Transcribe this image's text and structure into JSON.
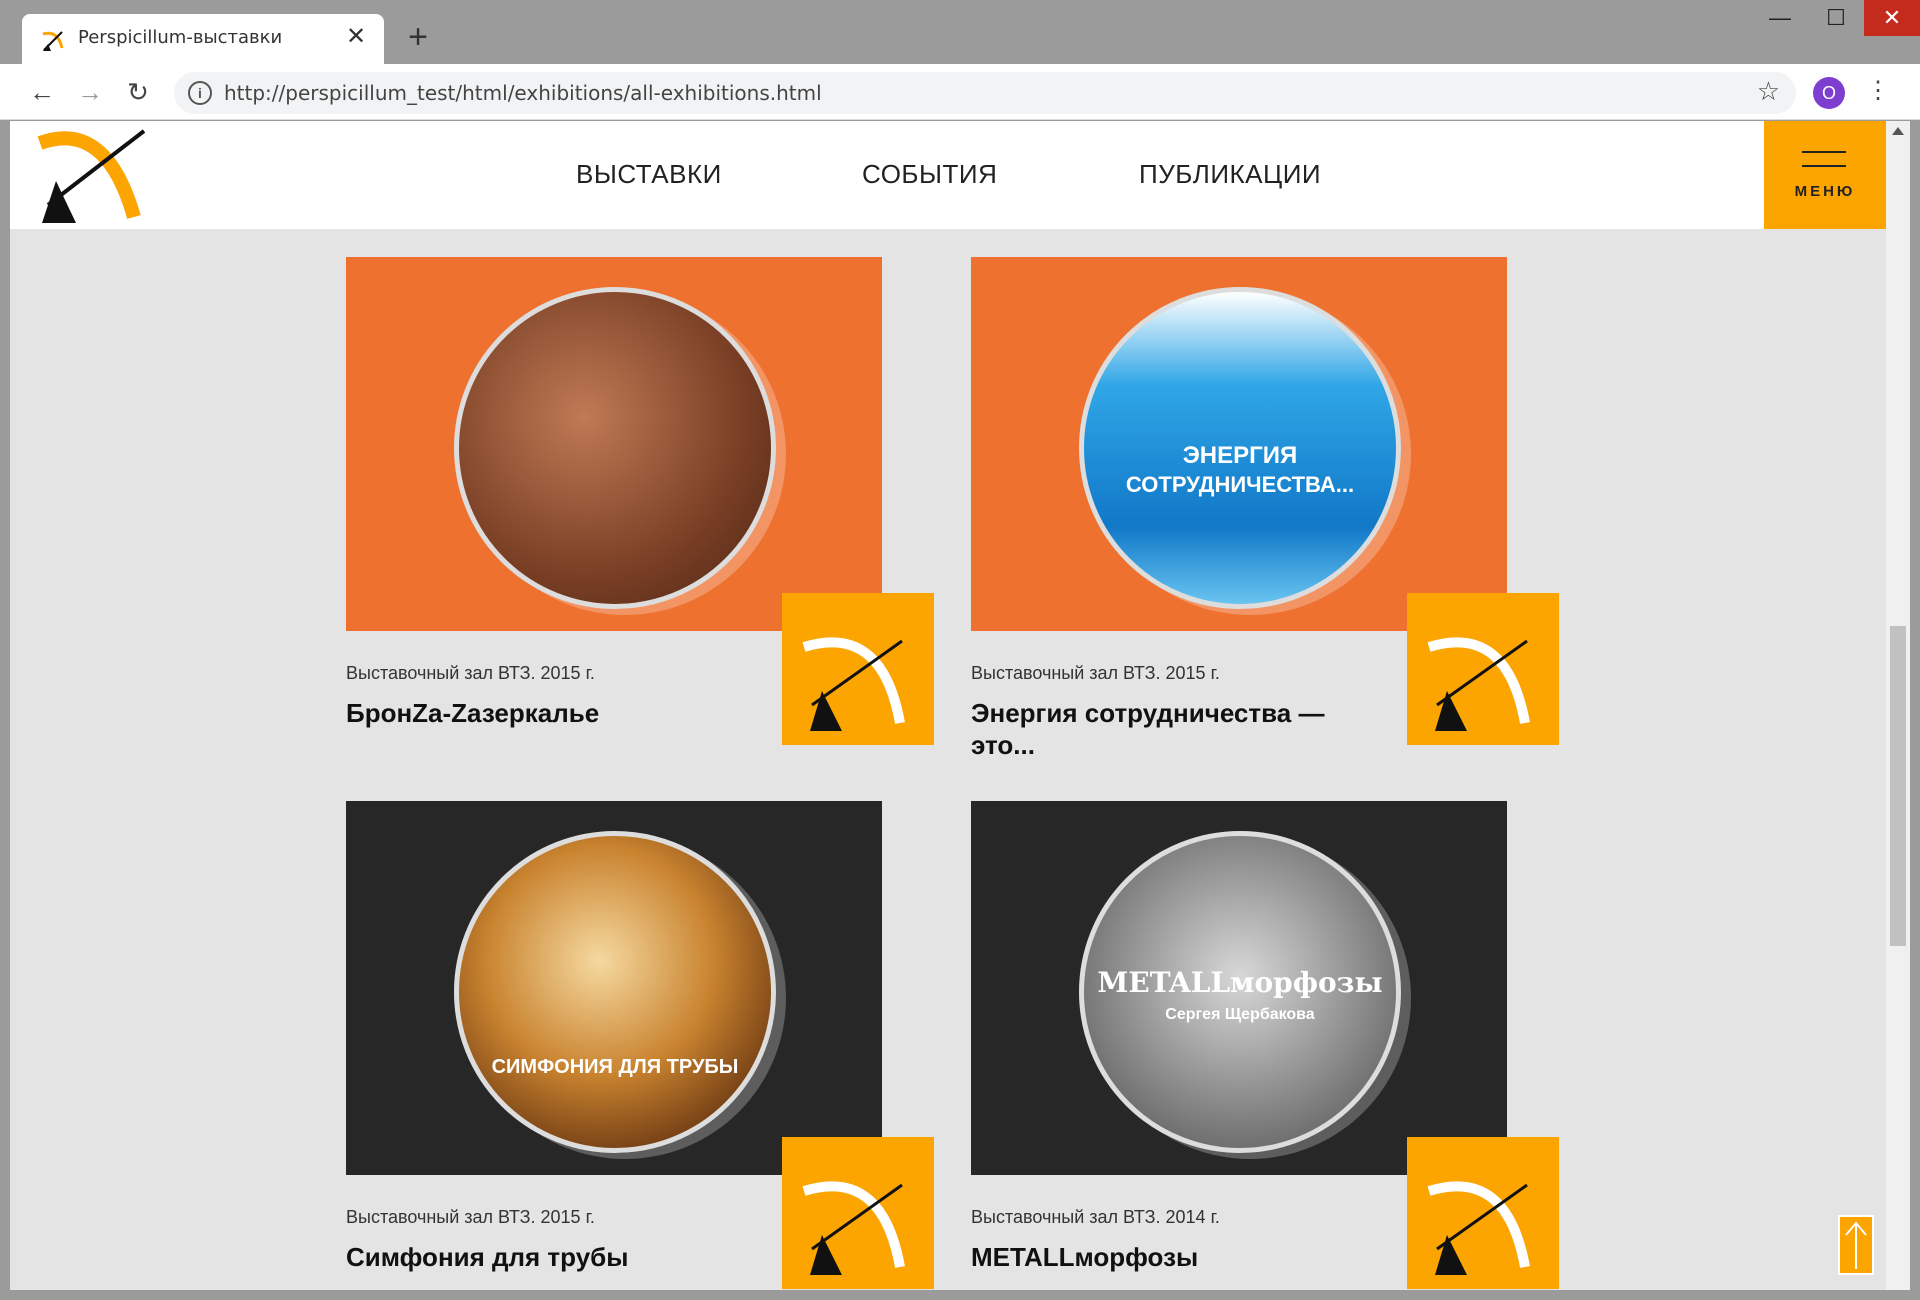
{
  "browser": {
    "tab_title": "Perspicillum-выставки",
    "tab_close": "✕",
    "new_tab": "+",
    "url": "http://perspicillum_test/html/exhibitions/all-exhibitions.html",
    "profile_initial": "O",
    "info_glyph": "i",
    "star_glyph": "☆",
    "kebab_glyph": "⋮",
    "back_glyph": "←",
    "forward_glyph": "→",
    "reload_glyph": "↻",
    "min_glyph": "—",
    "max_glyph": "☐",
    "close_glyph": "✕"
  },
  "site": {
    "nav": [
      {
        "label": "ВЫСТАВКИ"
      },
      {
        "label": "СОБЫТИЯ"
      },
      {
        "label": "ПУБЛИКАЦИИ"
      }
    ],
    "menu_label": "МЕНЮ"
  },
  "cards": [
    {
      "meta": "Выставочный зал ВТЗ. 2015 г.",
      "name": "БронZa-Zазеркалье",
      "disc_line1": "",
      "disc_line2": "",
      "theme": "orange"
    },
    {
      "meta": "Выставочный зал ВТЗ. 2015 г.",
      "name": "Энергия сотрудничества — это...",
      "disc_line1": "ЭНЕРГИЯ",
      "disc_line2": "СОТРУДНИЧЕСТВА...",
      "theme": "orange"
    },
    {
      "meta": "Выставочный зал ВТЗ. 2015 г.",
      "name": "Симфония для трубы",
      "disc_line1": "СИМФОНИЯ ДЛЯ ТРУБЫ",
      "disc_line2": "",
      "theme": "dark"
    },
    {
      "meta": "Выставочный зал ВТЗ. 2014 г.",
      "name": "METALLморфозы",
      "disc_line1": "METALLморфозы",
      "disc_line2": "Сергея Щербакова",
      "theme": "dark"
    }
  ],
  "colors": {
    "accent_orange": "#fca400",
    "card_orange": "#ee712f",
    "card_dark": "#272727"
  }
}
